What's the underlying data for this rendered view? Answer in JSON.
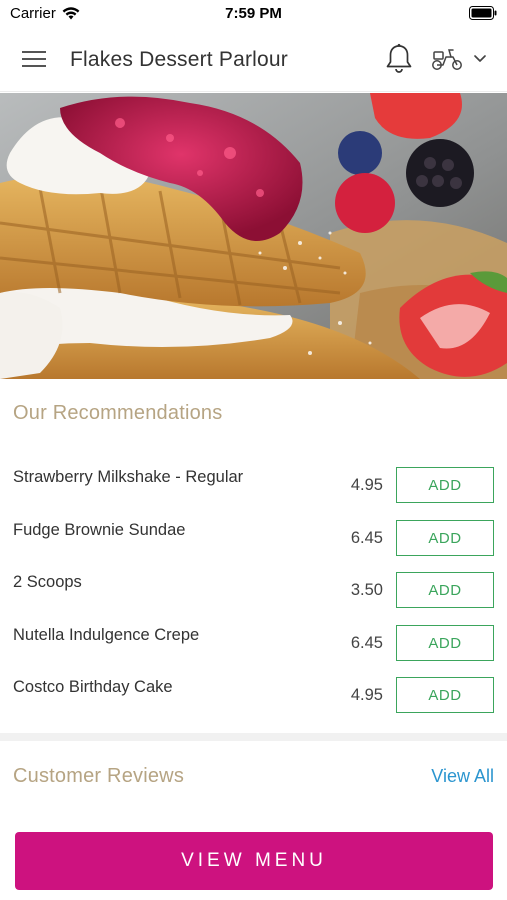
{
  "status_bar": {
    "carrier": "Carrier",
    "time": "7:59 PM"
  },
  "header": {
    "title": "Flakes Dessert Parlour",
    "icons": [
      "menu-icon",
      "bell-icon",
      "scooter-icon",
      "chevron-down-icon"
    ]
  },
  "hero": {
    "subject": "waffles with cream and berries"
  },
  "recommendations": {
    "title": "Our Recommendations",
    "items": [
      {
        "name": "Strawberry Milkshake - Regular",
        "price": "4.95",
        "action": "ADD"
      },
      {
        "name": "Fudge Brownie Sundae",
        "price": "6.45",
        "action": "ADD"
      },
      {
        "name": "2 Scoops",
        "price": "3.50",
        "action": "ADD"
      },
      {
        "name": "Nutella Indulgence Crepe",
        "price": "6.45",
        "action": "ADD"
      },
      {
        "name": "Costco Birthday Cake",
        "price": "4.95",
        "action": "ADD"
      }
    ]
  },
  "reviews": {
    "title": "Customer Reviews",
    "view_all": "View All"
  },
  "cta": {
    "label": "VIEW MENU"
  },
  "colors": {
    "accent": "#cd127f",
    "add_green": "#3ba55c",
    "section_title": "#b6a483",
    "link_blue": "#2b95cf"
  }
}
